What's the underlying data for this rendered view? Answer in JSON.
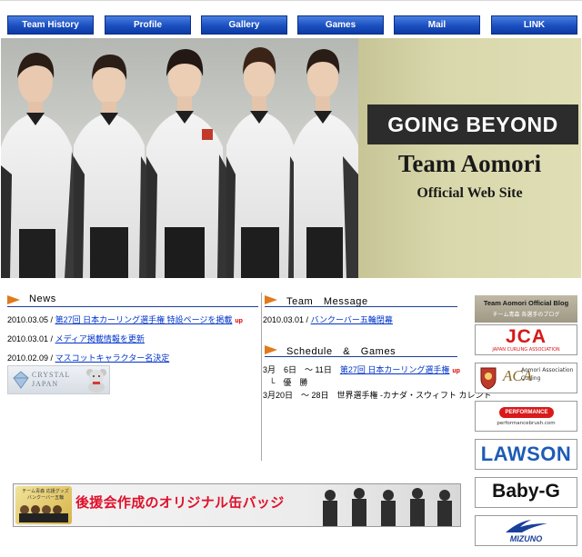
{
  "nav": [
    "Team History",
    "Profile",
    "Gallery",
    "Games",
    "Mail",
    "LINK"
  ],
  "hero": {
    "going_beyond": "GOING BEYOND",
    "team_name": "Team Aomori",
    "official_site": "Official Web Site"
  },
  "news": {
    "heading": "News",
    "items": [
      {
        "date": "2010.03.05",
        "sep": " / ",
        "link": "第27回 日本カーリング選手権 特設ページを掲載",
        "badge": "up"
      },
      {
        "date": "2010.03.01",
        "sep": " / ",
        "link": "メディア掲載情報を更新",
        "badge": ""
      },
      {
        "date": "2010.02.09",
        "sep": " / ",
        "link": "マスコットキャラクター名決定",
        "badge": ""
      }
    ],
    "crystal_label_1": "CRYSTAL",
    "crystal_label_2": "JAPAN"
  },
  "team_message": {
    "heading": "Team　Message",
    "items": [
      {
        "date": "2010.03.01",
        "sep": " / ",
        "link": "バンクーバー五輪閉幕"
      }
    ]
  },
  "schedule": {
    "heading": "Schedule　&　Games",
    "items": [
      {
        "date": "3月　6日　～ 11日",
        "link": "第27回 日本カーリング選手権",
        "badge": "up"
      },
      {
        "date": "",
        "link": "",
        "text": "└　優　勝"
      },
      {
        "date": "3月20日　～ 28日",
        "link": "",
        "text": "世界選手権 -カナダ・スウィフト カレント"
      }
    ]
  },
  "banner": {
    "small_text_1": "チーム青森 応援グッズ",
    "small_text_2": "バンクーバー五輪",
    "headline": "後援会作成のオリジナル缶バッジ"
  },
  "sponsors": {
    "blog_title": "Team Aomori Official Blog",
    "blog_sub": "チーム青森 各選手のブログ",
    "jca": "JCA",
    "jca_sub": "JAPAN CURLING ASSOCIATION",
    "aca": "ACA",
    "aca_sub": "Aomori Association Curling",
    "performance": "PERFORMANCE",
    "performance_sub": "performancebrush.com",
    "lawson": "LAWSON",
    "babyg": "Baby-G",
    "mizuno": "MIZUNO"
  },
  "colors": {
    "nav_blue": "#1b4fc0",
    "link_blue": "#0033cc",
    "accent_orange": "#e07a1a",
    "up_red": "#dd0000"
  }
}
